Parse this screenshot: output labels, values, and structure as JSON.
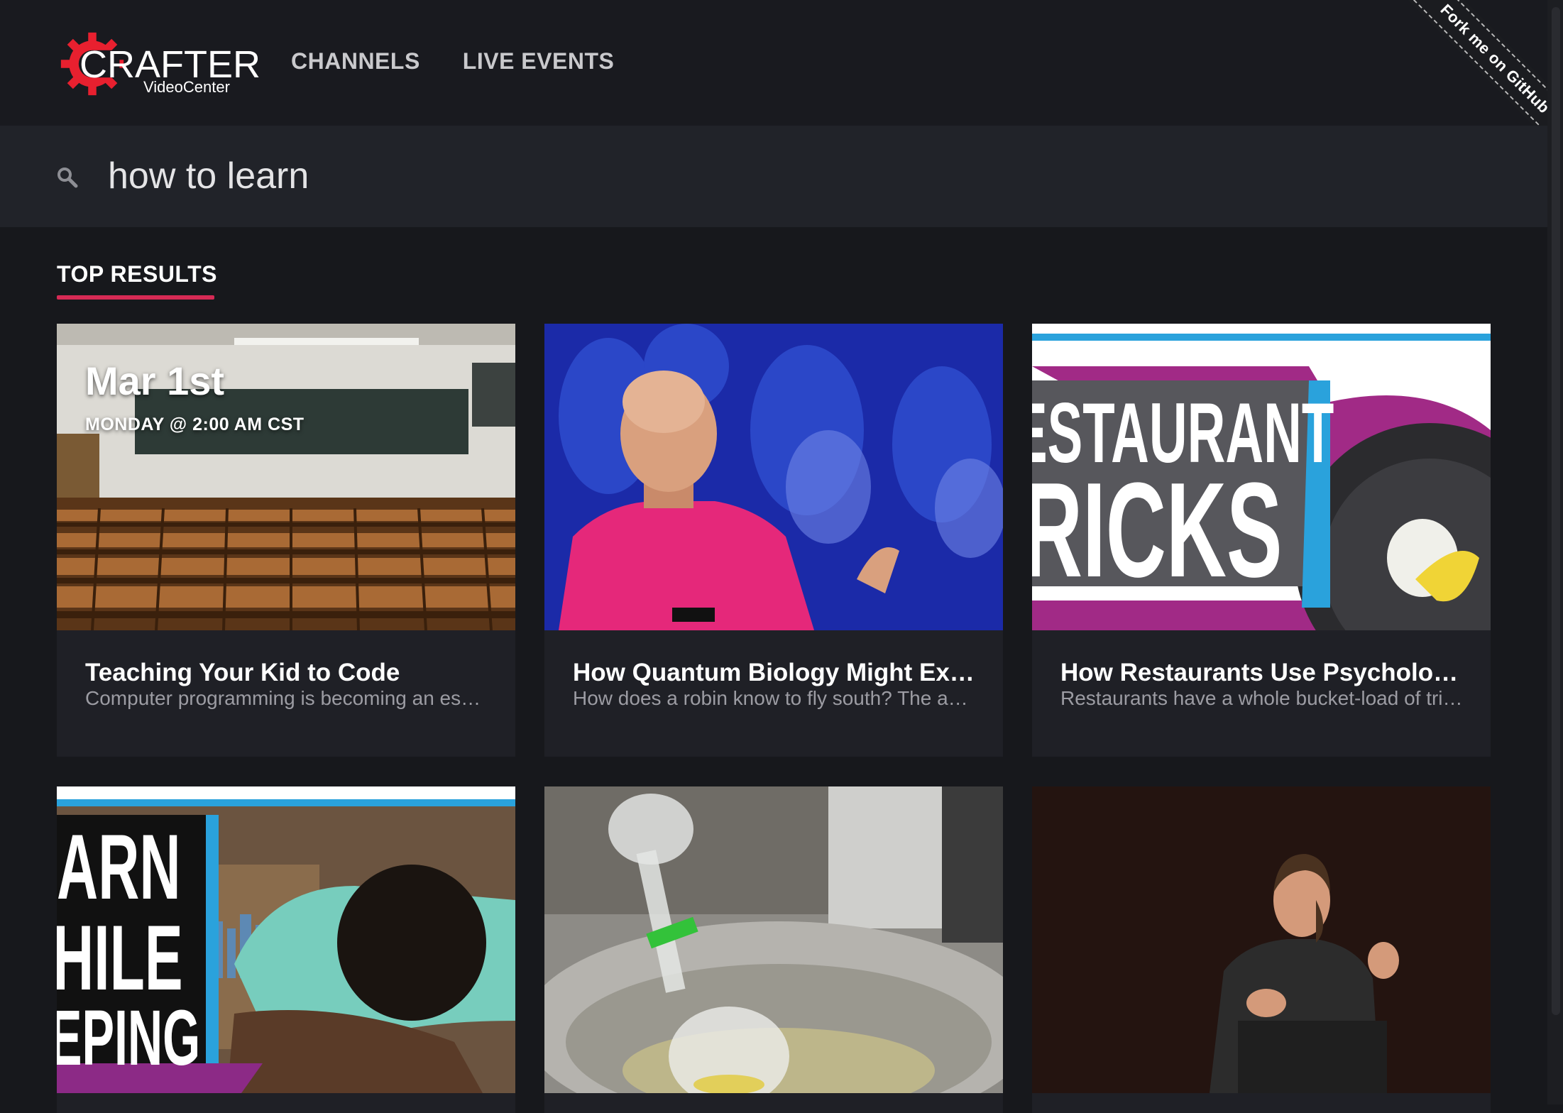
{
  "brand": {
    "name": "CRAFTER",
    "sub": "VideoCenter",
    "accent": "#e8202f"
  },
  "nav": [
    {
      "label": "CHANNELS"
    },
    {
      "label": "LIVE EVENTS"
    }
  ],
  "ribbon": {
    "label": "Fork me on GitHub"
  },
  "search": {
    "value": "how to learn",
    "placeholder": ""
  },
  "section": {
    "title": "TOP RESULTS",
    "underline_color": "#d62a55"
  },
  "cards": [
    {
      "thumb": "classroom-photo",
      "event_date": "Mar 1st",
      "event_time": "MONDAY @ 2:00 AM CST",
      "title": "Teaching Your Kid to Code",
      "desc": "Computer programming is becoming an es…"
    },
    {
      "thumb": "speaker-pink-shirt-photo",
      "title": "How Quantum Biology Might Ex…",
      "desc": "How does a robin know to fly south? The a…"
    },
    {
      "thumb": "restaurant-tricks-graphic",
      "overlay": [
        "ESTAURANT",
        "RICKS"
      ],
      "title": "How Restaurants Use Psycholo…",
      "desc": "Restaurants have a whole bucket-load of tri…"
    },
    {
      "thumb": "learn-while-sleeping-graphic",
      "overlay": [
        "ARN",
        "HILE",
        "EPING"
      ]
    },
    {
      "thumb": "lab-flask-photo"
    },
    {
      "thumb": "speaker-stage-photo"
    }
  ]
}
